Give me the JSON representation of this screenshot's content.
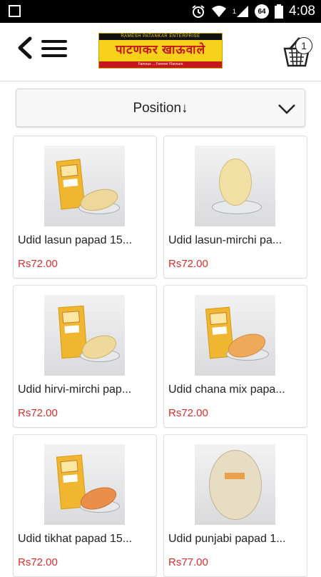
{
  "status_bar": {
    "clock": "4:08",
    "battery_badge": "64",
    "signal_sub": "1"
  },
  "header": {
    "logo": {
      "top_text": "RAMESH PATANKAR ENTERPRISE",
      "main_text": "पाटणकर खाऊवाले",
      "tag_text": "Famous ... Forever Flavours"
    },
    "cart_count": "1"
  },
  "sort": {
    "label": "Position↓"
  },
  "colors": {
    "price": "#d32f2f",
    "logo_yellow": "#f6d11a",
    "logo_red": "#c4161c"
  },
  "products": [
    {
      "name": "Udid lasun papad 15...",
      "price": "Rs72.00"
    },
    {
      "name": "Udid lasun-mirchi pa...",
      "price": "Rs72.00"
    },
    {
      "name": "Udid hirvi-mirchi pap...",
      "price": "Rs72.00"
    },
    {
      "name": "Udid chana mix papa...",
      "price": "Rs72.00"
    },
    {
      "name": "Udid tikhat papad 15...",
      "price": "Rs72.00"
    },
    {
      "name": "Udid punjabi papad 1...",
      "price": "Rs77.00"
    }
  ]
}
